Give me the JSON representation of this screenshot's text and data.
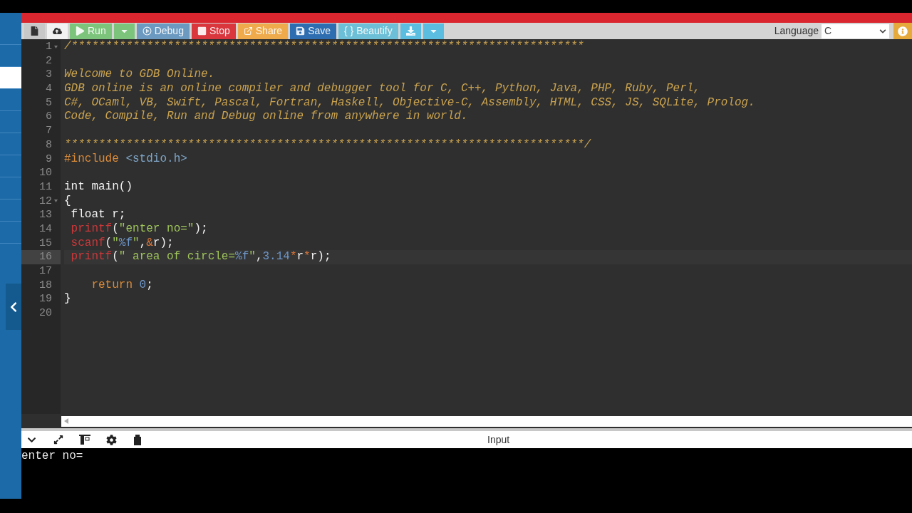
{
  "sidebar": {
    "items": [
      {
        "selected": false
      },
      {
        "selected": false
      },
      {
        "selected": true
      },
      {
        "selected": false
      },
      {
        "selected": false
      },
      {
        "selected": false
      },
      {
        "selected": false
      },
      {
        "selected": false
      },
      {
        "selected": false
      },
      {
        "selected": false
      }
    ]
  },
  "toolbar": {
    "buttons": [
      {
        "kind": "new",
        "color": "#c8c8c8"
      },
      {
        "kind": "upload",
        "color": "#f2f2f2"
      },
      {
        "kind": "run",
        "label": "Run",
        "color": "#7cc47c"
      },
      {
        "kind": "dropdown",
        "color": "#7cc47c"
      },
      {
        "kind": "debug",
        "label": "Debug",
        "color": "#6b99c0"
      },
      {
        "kind": "stop",
        "label": "Stop",
        "color": "#d9363e"
      },
      {
        "kind": "share",
        "label": "Share",
        "color": "#efaa4b"
      },
      {
        "kind": "save",
        "label": "Save",
        "color": "#2d6db0"
      },
      {
        "kind": "beautify",
        "label": "{ } Beautify",
        "color": "#6cbfd6"
      },
      {
        "kind": "download",
        "color": "#5bbde0"
      },
      {
        "kind": "dropdown",
        "color": "#5bbde0"
      }
    ],
    "language_label": "Language",
    "language_value": "C"
  },
  "editor": {
    "lines": [
      {
        "number": "1",
        "fold": true,
        "current": false,
        "tokens": [
          {
            "kind": "comment",
            "text": "/***************************************************************************"
          }
        ]
      },
      {
        "number": "2",
        "fold": false,
        "current": false
      },
      {
        "number": "3",
        "fold": false,
        "current": false,
        "tokens": [
          {
            "kind": "comment",
            "text": "Welcome to GDB Online."
          }
        ]
      },
      {
        "number": "4",
        "fold": false,
        "current": false,
        "tokens": [
          {
            "kind": "comment",
            "text": "GDB online is an online compiler and debugger tool for C, C++, Python, Java, PHP, Ruby, Perl,"
          }
        ]
      },
      {
        "number": "5",
        "fold": false,
        "current": false,
        "tokens": [
          {
            "kind": "comment",
            "text": "C#, OCaml, VB, Swift, Pascal, Fortran, Haskell, Objective-C, Assembly, HTML, CSS, JS, SQLite, Prolog."
          }
        ]
      },
      {
        "number": "6",
        "fold": false,
        "current": false,
        "tokens": [
          {
            "kind": "comment",
            "text": "Code, Compile, Run and Debug online from anywhere in world."
          }
        ]
      },
      {
        "number": "7",
        "fold": false,
        "current": false
      },
      {
        "number": "8",
        "fold": false,
        "current": false,
        "tokens": [
          {
            "kind": "comment",
            "text": "****************************************************************************/"
          }
        ]
      },
      {
        "number": "9",
        "fold": false,
        "current": false,
        "tokens": [
          {
            "kind": "directive",
            "text": "#include"
          },
          {
            "kind": "header",
            "text": " <stdio.h>"
          }
        ]
      },
      {
        "number": "10",
        "fold": false,
        "current": false
      },
      {
        "number": "11",
        "fold": false,
        "current": false,
        "tokens": [
          {
            "kind": "plain",
            "text": "int main()"
          }
        ]
      },
      {
        "number": "12",
        "fold": true,
        "current": false,
        "tokens": [
          {
            "kind": "plain",
            "text": "{"
          }
        ]
      },
      {
        "number": "13",
        "fold": false,
        "current": false,
        "tokens": [
          {
            "kind": "plain",
            "text": " float r;"
          }
        ]
      },
      {
        "number": "14",
        "fold": false,
        "current": false,
        "tokens": [
          {
            "kind": "function",
            "text": " printf"
          },
          {
            "kind": "plain",
            "text": "("
          },
          {
            "kind": "string",
            "text": "\"enter no=\""
          },
          {
            "kind": "plain",
            "text": ");"
          }
        ]
      },
      {
        "number": "15",
        "fold": false,
        "current": false,
        "tokens": [
          {
            "kind": "function",
            "text": " scanf"
          },
          {
            "kind": "plain",
            "text": "("
          },
          {
            "kind": "string",
            "text": "\""
          },
          {
            "kind": "format",
            "text": "%f"
          },
          {
            "kind": "string",
            "text": "\""
          },
          {
            "kind": "plain",
            "text": ","
          },
          {
            "kind": "operator",
            "text": "&"
          },
          {
            "kind": "plain",
            "text": "r);"
          }
        ]
      },
      {
        "number": "16",
        "fold": false,
        "current": true,
        "tokens": [
          {
            "kind": "function",
            "text": " printf"
          },
          {
            "kind": "plain",
            "text": "("
          },
          {
            "kind": "string",
            "text": "\" area of circle="
          },
          {
            "kind": "format",
            "text": "%f"
          },
          {
            "kind": "string",
            "text": "\""
          },
          {
            "kind": "plain",
            "text": ","
          },
          {
            "kind": "number",
            "text": "3.14"
          },
          {
            "kind": "operator",
            "text": "*"
          },
          {
            "kind": "plain",
            "text": "r"
          },
          {
            "kind": "operator",
            "text": "*"
          },
          {
            "kind": "plain",
            "text": "r);"
          }
        ]
      },
      {
        "number": "17",
        "fold": false,
        "current": false
      },
      {
        "number": "18",
        "fold": false,
        "current": false,
        "tokens": [
          {
            "kind": "keyword",
            "text": "    return"
          },
          {
            "kind": "number",
            "text": " 0"
          },
          {
            "kind": "plain",
            "text": ";"
          }
        ]
      },
      {
        "number": "19",
        "fold": false,
        "current": false,
        "tokens": [
          {
            "kind": "plain",
            "text": "}"
          }
        ]
      },
      {
        "number": "20",
        "fold": false,
        "current": false
      }
    ]
  },
  "console": {
    "title": "Input",
    "output": "enter no="
  }
}
